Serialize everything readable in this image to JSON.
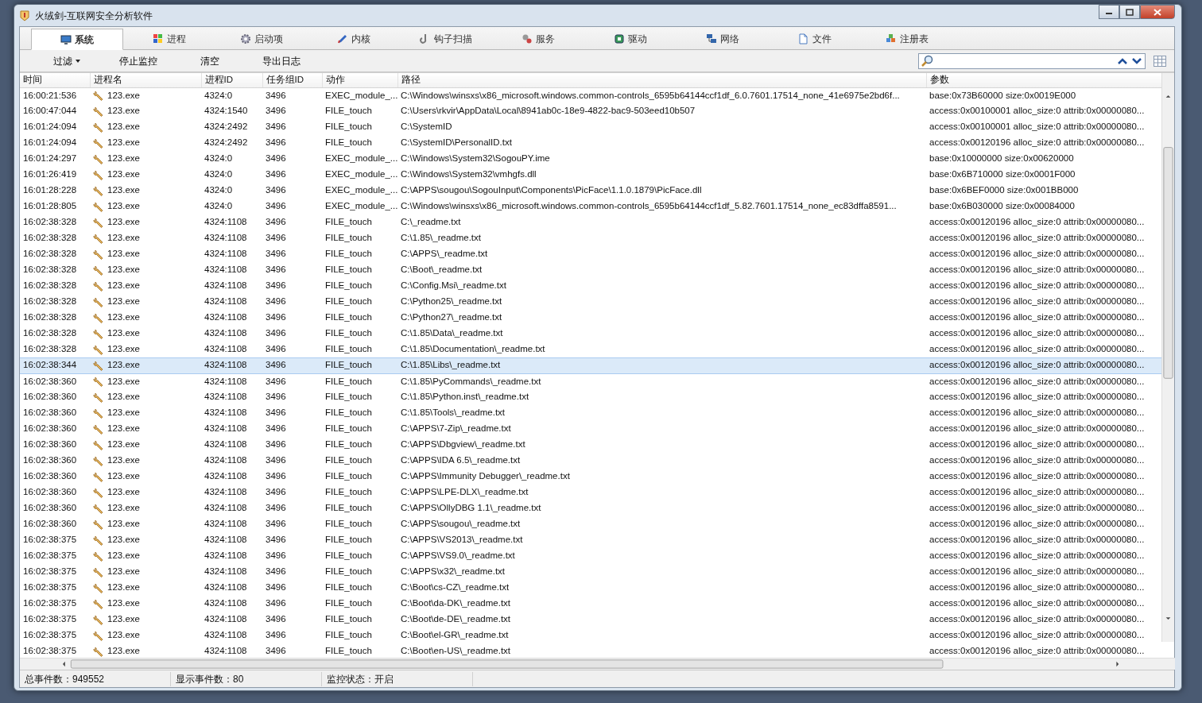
{
  "window": {
    "title": "火绒剑-互联网安全分析软件"
  },
  "tabs": [
    {
      "label": "系统",
      "selected": true
    },
    {
      "label": "进程",
      "selected": false
    },
    {
      "label": "启动项",
      "selected": false
    },
    {
      "label": "内核",
      "selected": false
    },
    {
      "label": "钩子扫描",
      "selected": false
    },
    {
      "label": "服务",
      "selected": false
    },
    {
      "label": "驱动",
      "selected": false
    },
    {
      "label": "网络",
      "selected": false
    },
    {
      "label": "文件",
      "selected": false
    },
    {
      "label": "注册表",
      "selected": false
    }
  ],
  "toolbar": [
    {
      "label": "过滤",
      "kind": "dropdown"
    },
    {
      "label": "停止监控",
      "kind": "button"
    },
    {
      "label": "清空",
      "kind": "button"
    },
    {
      "label": "导出日志",
      "kind": "button"
    }
  ],
  "table": {
    "columns": [
      "时间",
      "进程名",
      "进程ID",
      "任务组ID",
      "动作",
      "路径",
      "参数"
    ],
    "rows": [
      {
        "time": "16:00:21:536",
        "process": "123.exe",
        "pid": "4324:0",
        "tgid": "3496",
        "action": "EXEC_module_...",
        "path": "C:\\Windows\\winsxs\\x86_microsoft.windows.common-controls_6595b64144ccf1df_6.0.7601.17514_none_41e6975e2bd6f...",
        "params": "base:0x73B60000 size:0x0019E000",
        "selected": false
      },
      {
        "time": "16:00:47:044",
        "process": "123.exe",
        "pid": "4324:1540",
        "tgid": "3496",
        "action": "FILE_touch",
        "path": "C:\\Users\\rkvir\\AppData\\Local\\8941ab0c-18e9-4822-bac9-503eed10b507",
        "params": "access:0x00100001 alloc_size:0 attrib:0x00000080...",
        "selected": false
      },
      {
        "time": "16:01:24:094",
        "process": "123.exe",
        "pid": "4324:2492",
        "tgid": "3496",
        "action": "FILE_touch",
        "path": "C:\\SystemID",
        "params": "access:0x00100001 alloc_size:0 attrib:0x00000080...",
        "selected": false
      },
      {
        "time": "16:01:24:094",
        "process": "123.exe",
        "pid": "4324:2492",
        "tgid": "3496",
        "action": "FILE_touch",
        "path": "C:\\SystemID\\PersonalID.txt",
        "params": "access:0x00120196 alloc_size:0 attrib:0x00000080...",
        "selected": false
      },
      {
        "time": "16:01:24:297",
        "process": "123.exe",
        "pid": "4324:0",
        "tgid": "3496",
        "action": "EXEC_module_...",
        "path": "C:\\Windows\\System32\\SogouPY.ime",
        "params": "base:0x10000000 size:0x00620000",
        "selected": false
      },
      {
        "time": "16:01:26:419",
        "process": "123.exe",
        "pid": "4324:0",
        "tgid": "3496",
        "action": "EXEC_module_...",
        "path": "C:\\Windows\\System32\\vmhgfs.dll",
        "params": "base:0x6B710000 size:0x0001F000",
        "selected": false
      },
      {
        "time": "16:01:28:228",
        "process": "123.exe",
        "pid": "4324:0",
        "tgid": "3496",
        "action": "EXEC_module_...",
        "path": "C:\\APPS\\sougou\\SogouInput\\Components\\PicFace\\1.1.0.1879\\PicFace.dll",
        "params": "base:0x6BEF0000 size:0x001BB000",
        "selected": false
      },
      {
        "time": "16:01:28:805",
        "process": "123.exe",
        "pid": "4324:0",
        "tgid": "3496",
        "action": "EXEC_module_...",
        "path": "C:\\Windows\\winsxs\\x86_microsoft.windows.common-controls_6595b64144ccf1df_5.82.7601.17514_none_ec83dffa8591...",
        "params": "base:0x6B030000 size:0x00084000",
        "selected": false
      },
      {
        "time": "16:02:38:328",
        "process": "123.exe",
        "pid": "4324:1108",
        "tgid": "3496",
        "action": "FILE_touch",
        "path": "C:\\_readme.txt",
        "params": "access:0x00120196 alloc_size:0 attrib:0x00000080...",
        "selected": false
      },
      {
        "time": "16:02:38:328",
        "process": "123.exe",
        "pid": "4324:1108",
        "tgid": "3496",
        "action": "FILE_touch",
        "path": "C:\\1.85\\_readme.txt",
        "params": "access:0x00120196 alloc_size:0 attrib:0x00000080...",
        "selected": false
      },
      {
        "time": "16:02:38:328",
        "process": "123.exe",
        "pid": "4324:1108",
        "tgid": "3496",
        "action": "FILE_touch",
        "path": "C:\\APPS\\_readme.txt",
        "params": "access:0x00120196 alloc_size:0 attrib:0x00000080...",
        "selected": false
      },
      {
        "time": "16:02:38:328",
        "process": "123.exe",
        "pid": "4324:1108",
        "tgid": "3496",
        "action": "FILE_touch",
        "path": "C:\\Boot\\_readme.txt",
        "params": "access:0x00120196 alloc_size:0 attrib:0x00000080...",
        "selected": false
      },
      {
        "time": "16:02:38:328",
        "process": "123.exe",
        "pid": "4324:1108",
        "tgid": "3496",
        "action": "FILE_touch",
        "path": "C:\\Config.Msi\\_readme.txt",
        "params": "access:0x00120196 alloc_size:0 attrib:0x00000080...",
        "selected": false
      },
      {
        "time": "16:02:38:328",
        "process": "123.exe",
        "pid": "4324:1108",
        "tgid": "3496",
        "action": "FILE_touch",
        "path": "C:\\Python25\\_readme.txt",
        "params": "access:0x00120196 alloc_size:0 attrib:0x00000080...",
        "selected": false
      },
      {
        "time": "16:02:38:328",
        "process": "123.exe",
        "pid": "4324:1108",
        "tgid": "3496",
        "action": "FILE_touch",
        "path": "C:\\Python27\\_readme.txt",
        "params": "access:0x00120196 alloc_size:0 attrib:0x00000080...",
        "selected": false
      },
      {
        "time": "16:02:38:328",
        "process": "123.exe",
        "pid": "4324:1108",
        "tgid": "3496",
        "action": "FILE_touch",
        "path": "C:\\1.85\\Data\\_readme.txt",
        "params": "access:0x00120196 alloc_size:0 attrib:0x00000080...",
        "selected": false
      },
      {
        "time": "16:02:38:328",
        "process": "123.exe",
        "pid": "4324:1108",
        "tgid": "3496",
        "action": "FILE_touch",
        "path": "C:\\1.85\\Documentation\\_readme.txt",
        "params": "access:0x00120196 alloc_size:0 attrib:0x00000080...",
        "selected": false
      },
      {
        "time": "16:02:38:344",
        "process": "123.exe",
        "pid": "4324:1108",
        "tgid": "3496",
        "action": "FILE_touch",
        "path": "C:\\1.85\\Libs\\_readme.txt",
        "params": "access:0x00120196 alloc_size:0 attrib:0x00000080...",
        "selected": true
      },
      {
        "time": "16:02:38:360",
        "process": "123.exe",
        "pid": "4324:1108",
        "tgid": "3496",
        "action": "FILE_touch",
        "path": "C:\\1.85\\PyCommands\\_readme.txt",
        "params": "access:0x00120196 alloc_size:0 attrib:0x00000080...",
        "selected": false
      },
      {
        "time": "16:02:38:360",
        "process": "123.exe",
        "pid": "4324:1108",
        "tgid": "3496",
        "action": "FILE_touch",
        "path": "C:\\1.85\\Python.inst\\_readme.txt",
        "params": "access:0x00120196 alloc_size:0 attrib:0x00000080...",
        "selected": false
      },
      {
        "time": "16:02:38:360",
        "process": "123.exe",
        "pid": "4324:1108",
        "tgid": "3496",
        "action": "FILE_touch",
        "path": "C:\\1.85\\Tools\\_readme.txt",
        "params": "access:0x00120196 alloc_size:0 attrib:0x00000080...",
        "selected": false
      },
      {
        "time": "16:02:38:360",
        "process": "123.exe",
        "pid": "4324:1108",
        "tgid": "3496",
        "action": "FILE_touch",
        "path": "C:\\APPS\\7-Zip\\_readme.txt",
        "params": "access:0x00120196 alloc_size:0 attrib:0x00000080...",
        "selected": false
      },
      {
        "time": "16:02:38:360",
        "process": "123.exe",
        "pid": "4324:1108",
        "tgid": "3496",
        "action": "FILE_touch",
        "path": "C:\\APPS\\Dbgview\\_readme.txt",
        "params": "access:0x00120196 alloc_size:0 attrib:0x00000080...",
        "selected": false
      },
      {
        "time": "16:02:38:360",
        "process": "123.exe",
        "pid": "4324:1108",
        "tgid": "3496",
        "action": "FILE_touch",
        "path": "C:\\APPS\\IDA 6.5\\_readme.txt",
        "params": "access:0x00120196 alloc_size:0 attrib:0x00000080...",
        "selected": false
      },
      {
        "time": "16:02:38:360",
        "process": "123.exe",
        "pid": "4324:1108",
        "tgid": "3496",
        "action": "FILE_touch",
        "path": "C:\\APPS\\Immunity Debugger\\_readme.txt",
        "params": "access:0x00120196 alloc_size:0 attrib:0x00000080...",
        "selected": false
      },
      {
        "time": "16:02:38:360",
        "process": "123.exe",
        "pid": "4324:1108",
        "tgid": "3496",
        "action": "FILE_touch",
        "path": "C:\\APPS\\LPE-DLX\\_readme.txt",
        "params": "access:0x00120196 alloc_size:0 attrib:0x00000080...",
        "selected": false
      },
      {
        "time": "16:02:38:360",
        "process": "123.exe",
        "pid": "4324:1108",
        "tgid": "3496",
        "action": "FILE_touch",
        "path": "C:\\APPS\\OllyDBG 1.1\\_readme.txt",
        "params": "access:0x00120196 alloc_size:0 attrib:0x00000080...",
        "selected": false
      },
      {
        "time": "16:02:38:360",
        "process": "123.exe",
        "pid": "4324:1108",
        "tgid": "3496",
        "action": "FILE_touch",
        "path": "C:\\APPS\\sougou\\_readme.txt",
        "params": "access:0x00120196 alloc_size:0 attrib:0x00000080...",
        "selected": false
      },
      {
        "time": "16:02:38:375",
        "process": "123.exe",
        "pid": "4324:1108",
        "tgid": "3496",
        "action": "FILE_touch",
        "path": "C:\\APPS\\VS2013\\_readme.txt",
        "params": "access:0x00120196 alloc_size:0 attrib:0x00000080...",
        "selected": false
      },
      {
        "time": "16:02:38:375",
        "process": "123.exe",
        "pid": "4324:1108",
        "tgid": "3496",
        "action": "FILE_touch",
        "path": "C:\\APPS\\VS9.0\\_readme.txt",
        "params": "access:0x00120196 alloc_size:0 attrib:0x00000080...",
        "selected": false
      },
      {
        "time": "16:02:38:375",
        "process": "123.exe",
        "pid": "4324:1108",
        "tgid": "3496",
        "action": "FILE_touch",
        "path": "C:\\APPS\\x32\\_readme.txt",
        "params": "access:0x00120196 alloc_size:0 attrib:0x00000080...",
        "selected": false
      },
      {
        "time": "16:02:38:375",
        "process": "123.exe",
        "pid": "4324:1108",
        "tgid": "3496",
        "action": "FILE_touch",
        "path": "C:\\Boot\\cs-CZ\\_readme.txt",
        "params": "access:0x00120196 alloc_size:0 attrib:0x00000080...",
        "selected": false
      },
      {
        "time": "16:02:38:375",
        "process": "123.exe",
        "pid": "4324:1108",
        "tgid": "3496",
        "action": "FILE_touch",
        "path": "C:\\Boot\\da-DK\\_readme.txt",
        "params": "access:0x00120196 alloc_size:0 attrib:0x00000080...",
        "selected": false
      },
      {
        "time": "16:02:38:375",
        "process": "123.exe",
        "pid": "4324:1108",
        "tgid": "3496",
        "action": "FILE_touch",
        "path": "C:\\Boot\\de-DE\\_readme.txt",
        "params": "access:0x00120196 alloc_size:0 attrib:0x00000080...",
        "selected": false
      },
      {
        "time": "16:02:38:375",
        "process": "123.exe",
        "pid": "4324:1108",
        "tgid": "3496",
        "action": "FILE_touch",
        "path": "C:\\Boot\\el-GR\\_readme.txt",
        "params": "access:0x00120196 alloc_size:0 attrib:0x00000080...",
        "selected": false
      },
      {
        "time": "16:02:38:375",
        "process": "123.exe",
        "pid": "4324:1108",
        "tgid": "3496",
        "action": "FILE_touch",
        "path": "C:\\Boot\\en-US\\_readme.txt",
        "params": "access:0x00120196 alloc_size:0 attrib:0x00000080...",
        "selected": false
      }
    ]
  },
  "status_bar": [
    "总事件数：949552",
    "显示事件数：80",
    "监控状态：开启"
  ]
}
